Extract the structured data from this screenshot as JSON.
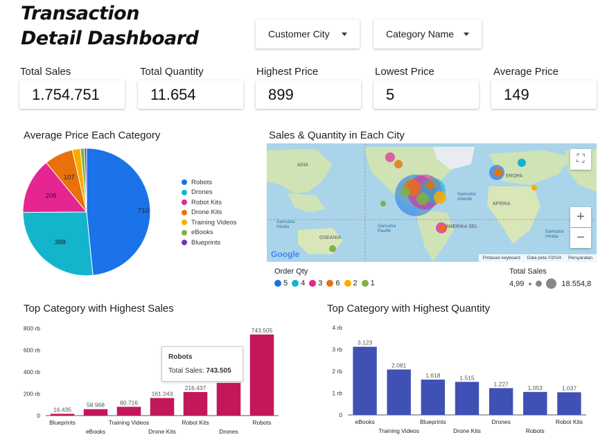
{
  "header": {
    "title_line1": "Transaction",
    "title_line2": "Detail Dashboard",
    "filters": [
      {
        "label": "Customer City"
      },
      {
        "label": "Category Name"
      }
    ]
  },
  "kpis": [
    {
      "label": "Total Sales",
      "value": "1.754.751"
    },
    {
      "label": "Total Quantity",
      "value": "11.654"
    },
    {
      "label": "Highest Price",
      "value": "899"
    },
    {
      "label": "Lowest Price",
      "value": "5"
    },
    {
      "label": "Average Price",
      "value": "149"
    }
  ],
  "pie": {
    "title": "Average Price Each Category",
    "chart_data": {
      "type": "pie",
      "slices": [
        {
          "name": "Robots",
          "value": 710,
          "label": "710",
          "color": "#1a73e8"
        },
        {
          "name": "Drones",
          "value": 388,
          "label": "388",
          "color": "#12b5cb"
        },
        {
          "name": "Robot Kits",
          "value": 208,
          "label": "208",
          "color": "#e52592"
        },
        {
          "name": "Drone Kits",
          "value": 107,
          "label": "107",
          "color": "#e8710a"
        },
        {
          "name": "Training Videos",
          "value": 30,
          "label": "",
          "color": "#f9ab00"
        },
        {
          "name": "eBooks",
          "value": 15,
          "label": "",
          "color": "#7cb342"
        },
        {
          "name": "Blueprints",
          "value": 8,
          "label": "",
          "color": "#673ab7"
        }
      ]
    }
  },
  "map": {
    "title": "Sales & Quantity in Each City",
    "labels": {
      "asia": "ASIA",
      "eropa": "EROPA",
      "samudra_atlantik": "Samudra Atlantik",
      "afrika": "AFRIKA",
      "samudra_hindia_left": "Samudra Hindia",
      "samudra_pasifik": "Samudra Pasifik",
      "oseania": "OSEANIA",
      "amerika_sel": "AMERIKA SEL",
      "samudra_hindia_right": "Samudra Hindia"
    },
    "google_logo": "Google",
    "footer": [
      "Pintasan keyboard",
      "Data peta ©2024",
      "Persyaratan"
    ],
    "zoom_in": "+",
    "zoom_out": "−",
    "order_qty_title": "Order Qty",
    "order_qty_items": [
      {
        "label": "5",
        "color": "#1a73e8"
      },
      {
        "label": "4",
        "color": "#12b5cb"
      },
      {
        "label": "3",
        "color": "#e52592"
      },
      {
        "label": "6",
        "color": "#e8710a"
      },
      {
        "label": "2",
        "color": "#f9ab00"
      },
      {
        "label": "1",
        "color": "#7cb342"
      }
    ],
    "total_sales_title": "Total Sales",
    "total_sales_min": "4,99",
    "total_sales_max": "18.554,8"
  },
  "bar_sales": {
    "title": "Top Category with Highest Sales",
    "tooltip": {
      "title": "Robots",
      "label": "Total Sales:",
      "value": "743.505"
    },
    "chart_data": {
      "type": "bar",
      "categories": [
        "Blueprints",
        "eBooks",
        "Training Videos",
        "Drone Kits",
        "Robot Kits",
        "Drones",
        "Robots"
      ],
      "values": [
        16435,
        58968,
        80716,
        161243,
        216437,
        300000,
        743505
      ],
      "value_labels": [
        "16.435",
        "58.968",
        "80.716",
        "161.243",
        "216.437",
        "",
        "743.505"
      ],
      "ylim": [
        0,
        800000
      ],
      "yticks": [
        0,
        200000,
        400000,
        600000,
        800000
      ],
      "ytick_labels": [
        "0",
        "200 rb",
        "400 rb",
        "600 rb",
        "800 rb"
      ],
      "color": "#c2185b"
    }
  },
  "bar_qty": {
    "title": "Top  Category with Highest Quantity",
    "chart_data": {
      "type": "bar",
      "categories": [
        "eBooks",
        "Training Videos",
        "Blueprints",
        "Drone Kits",
        "Drones",
        "Robots",
        "Robot Kits"
      ],
      "values": [
        3123,
        2081,
        1618,
        1515,
        1227,
        1053,
        1037
      ],
      "value_labels": [
        "3.123",
        "2.081",
        "1.618",
        "1.515",
        "1.227",
        "1.053",
        "1.037"
      ],
      "ylim": [
        0,
        4000
      ],
      "yticks": [
        0,
        1000,
        2000,
        3000,
        4000
      ],
      "ytick_labels": [
        "0",
        "1 rb",
        "2 rb",
        "3 rb",
        "4 rb"
      ],
      "color": "#3f51b5"
    }
  }
}
